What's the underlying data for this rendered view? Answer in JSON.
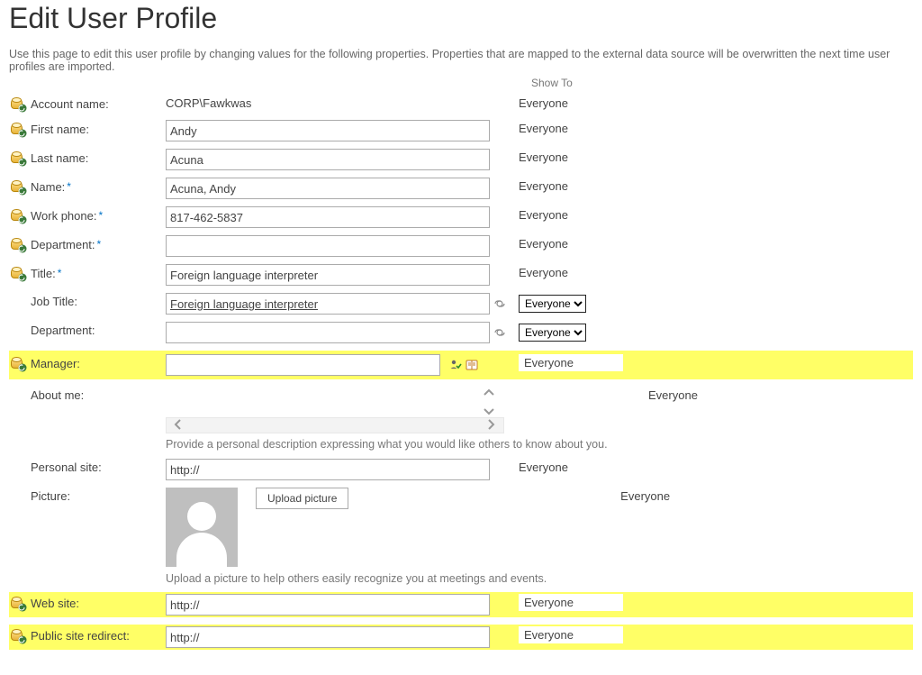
{
  "page": {
    "title": "Edit User Profile",
    "intro": "Use this page to edit this user profile by changing values for the following properties. Properties that are mapped to the external data source will be overwritten the next time user profiles are imported.",
    "show_to_header": "Show To"
  },
  "fields": {
    "account_name": {
      "label": "Account name:",
      "value": "CORP\\Fawkwas",
      "showto": "Everyone"
    },
    "first_name": {
      "label": "First name:",
      "value": "Andy",
      "showto": "Everyone"
    },
    "last_name": {
      "label": "Last name:",
      "value": "Acuna",
      "showto": "Everyone"
    },
    "name": {
      "label": "Name:",
      "value": "Acuna, Andy",
      "showto": "Everyone"
    },
    "work_phone": {
      "label": "Work phone:",
      "value": "817-462-5837",
      "showto": "Everyone"
    },
    "department": {
      "label": "Department:",
      "value": "",
      "showto": "Everyone"
    },
    "title": {
      "label": "Title:",
      "value": "Foreign language interpreter",
      "showto": "Everyone"
    },
    "job_title": {
      "label": "Job Title:",
      "value": "Foreign language interpreter",
      "showto": "Everyone"
    },
    "department2": {
      "label": "Department:",
      "value": "",
      "showto": "Everyone"
    },
    "manager": {
      "label": "Manager:",
      "value": "",
      "showto": "Everyone"
    },
    "about_me": {
      "label": "About me:",
      "desc": "Provide a personal description expressing what you would like others to know about you.",
      "showto": "Everyone"
    },
    "personal_site": {
      "label": "Personal site:",
      "value": "http://",
      "showto": "Everyone"
    },
    "picture": {
      "label": "Picture:",
      "button": "Upload picture",
      "desc": "Upload a picture to help others easily recognize you at meetings and events.",
      "showto": "Everyone"
    },
    "web_site": {
      "label": "Web site:",
      "value": "http://",
      "showto": "Everyone"
    },
    "public_redirect": {
      "label": "Public site redirect:",
      "value": "http://",
      "showto": "Everyone"
    }
  },
  "star": "*",
  "showto_options": [
    "Everyone"
  ]
}
